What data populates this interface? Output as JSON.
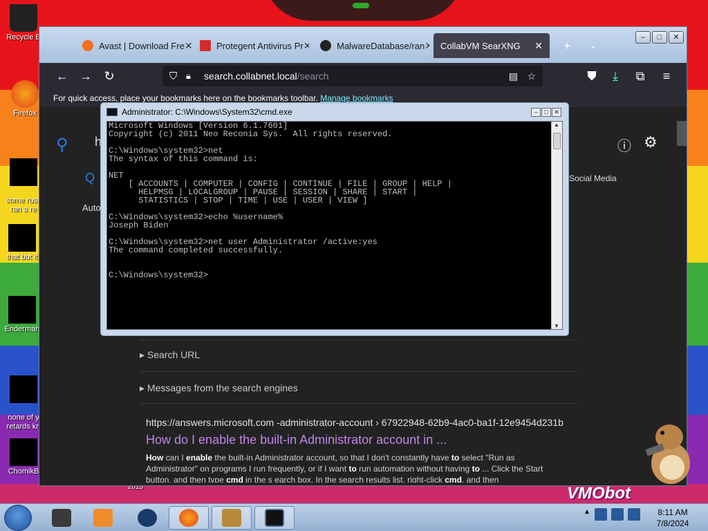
{
  "desktop": {
    "icons": [
      {
        "name": "recycle-bin",
        "label": "Recycle B"
      },
      {
        "name": "firefox",
        "label": "Firefox"
      },
      {
        "name": "russ",
        "label": "some russ\nran a re"
      },
      {
        "name": "that-but",
        "label": "that but it"
      },
      {
        "name": "enderman",
        "label": "Enderman"
      },
      {
        "name": "none-of",
        "label": "none of y\nretards kn"
      },
      {
        "name": "chomik",
        "label": "ChomikB"
      }
    ],
    "bottom_label": "2015",
    "watermark": "VMObot"
  },
  "browser": {
    "tabs": [
      {
        "label": "Avast | Download Fre",
        "icon": "avast-icon",
        "color": "#f36f21"
      },
      {
        "label": "Protegent Antivirus Pr",
        "icon": "protegent-icon",
        "color": "#d42a2a"
      },
      {
        "label": "MalwareDatabase/ran",
        "icon": "github-icon",
        "color": "#222222"
      },
      {
        "label": "CollabVM SearXNG",
        "icon": "",
        "color": "",
        "active": true
      }
    ],
    "url_host": "search.collabnet.local",
    "url_path": "/search",
    "bookmarks_text": "For quick access, place your bookmarks here on the bookmarks toolbar.",
    "bookmarks_link": "Manage bookmarks"
  },
  "search_page": {
    "partial_query": "h",
    "partial_tab": "Social Media",
    "partial_auto": "Auto",
    "collapse_search_url": "▸ Search URL",
    "collapse_messages": "▸ Messages from the search engines",
    "result": {
      "url": "https://answers.microsoft.com  -administrator-account › 67922948-62b9-4ac0-ba1f-12e9454d231b",
      "title": "How do I enable the built-in Administrator account in ...",
      "snippet_html": "<b>How</b> can I <b>enable</b> the built-in Administrator account, so that I don't constantly have <b>to</b> select \"Run as Administrator\" on programs I run frequently, or if I want <b>to</b> run automation without having <b>to</b> ... Click the Start button, and then type <b>cmd</b> in the s earch box. In the search results list, right-click <b>cmd</b>, and then"
    }
  },
  "cmd": {
    "title": "Administrator: C:\\Windows\\System32\\cmd.exe",
    "output": "Microsoft Windows [Version 6.1.7601]\nCopyright (c) 2011 Neo Reconia Sys.  All rights reserved.\n\nC:\\Windows\\system32>net\nThe syntax of this command is:\n\nNET\n    [ ACCOUNTS | COMPUTER | CONFIG | CONTINUE | FILE | GROUP | HELP |\n      HELPMSG | LOCALGROUP | PAUSE | SESSION | SHARE | START |\n      STATISTICS | STOP | TIME | USE | USER | VIEW ]\n\nC:\\Windows\\system32>echo %username%\nJoseph Biden\n\nC:\\Windows\\system32>net user Administrator /active:yes\nThe command completed successfully.\n\n\nC:\\Windows\\system32>"
  },
  "taskbar": {
    "items": [
      {
        "name": "pc-icon",
        "color": "#3a3a3a"
      },
      {
        "name": "media-player-icon",
        "color": "#f08a2a"
      },
      {
        "name": "globe-icon",
        "color": "#1a3a6a"
      },
      {
        "name": "firefox-icon",
        "color": "#f07a1a"
      },
      {
        "name": "box-game-icon",
        "color": "#b58a3a"
      },
      {
        "name": "cmd-icon",
        "color": "#111111"
      }
    ],
    "time": "8:11 AM",
    "date": "7/8/2024"
  }
}
